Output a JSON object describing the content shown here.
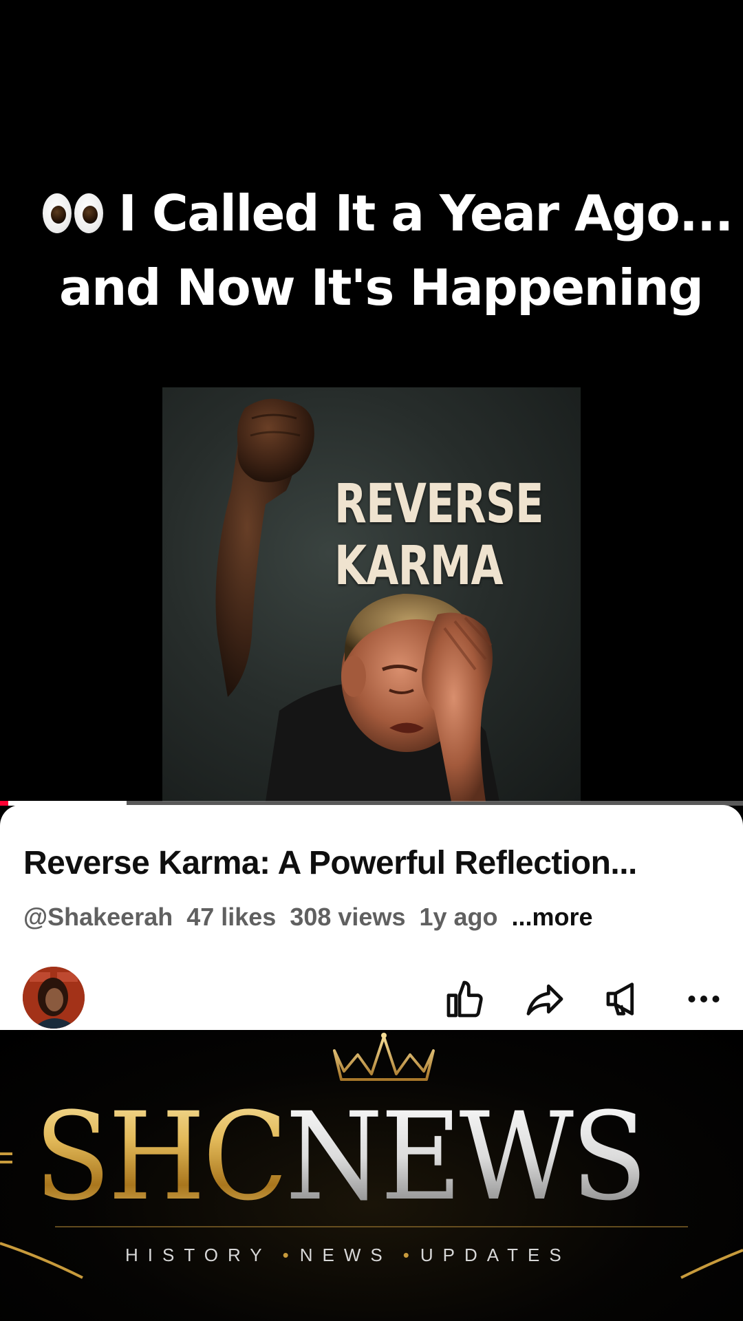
{
  "caption": {
    "eyes_icon": "eyes-emoji",
    "line1": "I Called It a Year Ago...",
    "line2": "and Now It's Happening"
  },
  "thumbnail": {
    "title_line1": "REVERSE",
    "title_line2": "KARMA"
  },
  "progress": {
    "fraction": 0.17,
    "accent_color": "#ff0033"
  },
  "video": {
    "title": "Reverse Karma: A Powerful Reflection...",
    "channel": "@Shakeerah",
    "likes": "47 likes",
    "views": "308 views",
    "age": "1y ago",
    "more_label": "...more"
  },
  "actions": [
    {
      "name": "like",
      "icon": "thumbs-up-icon"
    },
    {
      "name": "share",
      "icon": "share-arrow-icon"
    },
    {
      "name": "promote",
      "icon": "megaphone-icon"
    },
    {
      "name": "more",
      "icon": "more-dots-icon"
    }
  ],
  "brand": {
    "word_gold": "SHC",
    "word_silver": "NEWS",
    "tagline_1": "HISTORY",
    "tagline_2": "NEWS",
    "tagline_3": "UPDATES",
    "separator": "•"
  }
}
